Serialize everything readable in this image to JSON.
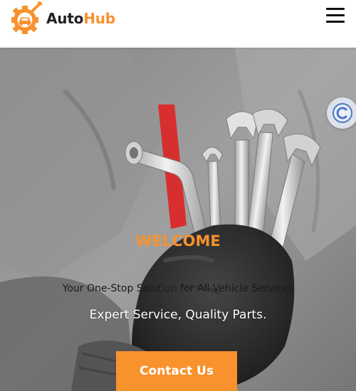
{
  "header": {
    "brand_part1": "Auto",
    "brand_part2": "Hub",
    "menu_icon": "hamburger-menu-icon"
  },
  "hero": {
    "heading": "WELCOME",
    "tagline": "Your One-Stop Solution for All Vehicle Services",
    "subheading": "Expert Service, Quality Parts.",
    "cta_label": "Contact Us"
  },
  "floating_widget": {
    "icon": "c-badge-icon"
  },
  "colors": {
    "accent": "#f7922d",
    "text_dark": "#222222"
  }
}
